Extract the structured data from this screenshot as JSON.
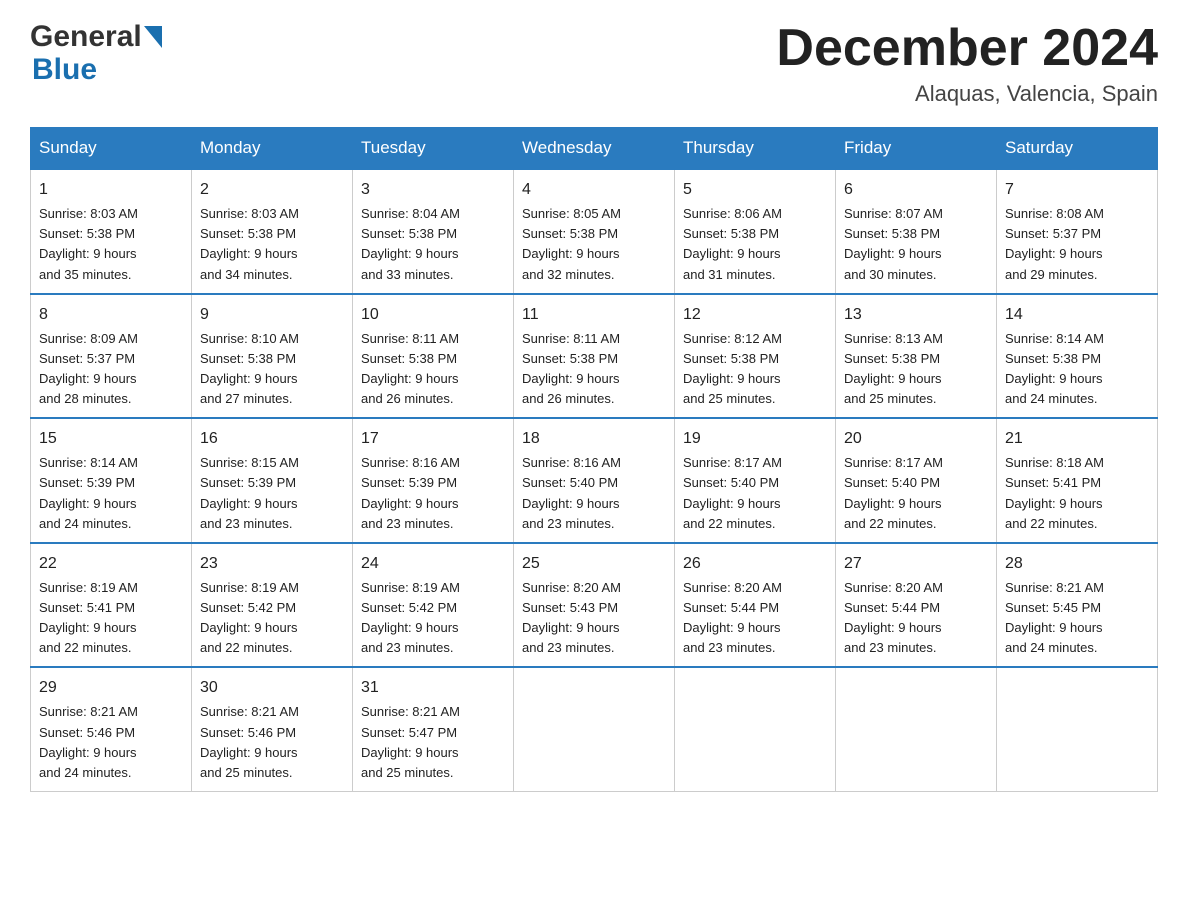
{
  "header": {
    "logo_line1": "General",
    "logo_line2": "Blue",
    "month_title": "December 2024",
    "location": "Alaquas, Valencia, Spain"
  },
  "days_of_week": [
    "Sunday",
    "Monday",
    "Tuesday",
    "Wednesday",
    "Thursday",
    "Friday",
    "Saturday"
  ],
  "weeks": [
    [
      {
        "day": "1",
        "sunrise": "8:03 AM",
        "sunset": "5:38 PM",
        "daylight": "9 hours and 35 minutes."
      },
      {
        "day": "2",
        "sunrise": "8:03 AM",
        "sunset": "5:38 PM",
        "daylight": "9 hours and 34 minutes."
      },
      {
        "day": "3",
        "sunrise": "8:04 AM",
        "sunset": "5:38 PM",
        "daylight": "9 hours and 33 minutes."
      },
      {
        "day": "4",
        "sunrise": "8:05 AM",
        "sunset": "5:38 PM",
        "daylight": "9 hours and 32 minutes."
      },
      {
        "day": "5",
        "sunrise": "8:06 AM",
        "sunset": "5:38 PM",
        "daylight": "9 hours and 31 minutes."
      },
      {
        "day": "6",
        "sunrise": "8:07 AM",
        "sunset": "5:38 PM",
        "daylight": "9 hours and 30 minutes."
      },
      {
        "day": "7",
        "sunrise": "8:08 AM",
        "sunset": "5:37 PM",
        "daylight": "9 hours and 29 minutes."
      }
    ],
    [
      {
        "day": "8",
        "sunrise": "8:09 AM",
        "sunset": "5:37 PM",
        "daylight": "9 hours and 28 minutes."
      },
      {
        "day": "9",
        "sunrise": "8:10 AM",
        "sunset": "5:38 PM",
        "daylight": "9 hours and 27 minutes."
      },
      {
        "day": "10",
        "sunrise": "8:11 AM",
        "sunset": "5:38 PM",
        "daylight": "9 hours and 26 minutes."
      },
      {
        "day": "11",
        "sunrise": "8:11 AM",
        "sunset": "5:38 PM",
        "daylight": "9 hours and 26 minutes."
      },
      {
        "day": "12",
        "sunrise": "8:12 AM",
        "sunset": "5:38 PM",
        "daylight": "9 hours and 25 minutes."
      },
      {
        "day": "13",
        "sunrise": "8:13 AM",
        "sunset": "5:38 PM",
        "daylight": "9 hours and 25 minutes."
      },
      {
        "day": "14",
        "sunrise": "8:14 AM",
        "sunset": "5:38 PM",
        "daylight": "9 hours and 24 minutes."
      }
    ],
    [
      {
        "day": "15",
        "sunrise": "8:14 AM",
        "sunset": "5:39 PM",
        "daylight": "9 hours and 24 minutes."
      },
      {
        "day": "16",
        "sunrise": "8:15 AM",
        "sunset": "5:39 PM",
        "daylight": "9 hours and 23 minutes."
      },
      {
        "day": "17",
        "sunrise": "8:16 AM",
        "sunset": "5:39 PM",
        "daylight": "9 hours and 23 minutes."
      },
      {
        "day": "18",
        "sunrise": "8:16 AM",
        "sunset": "5:40 PM",
        "daylight": "9 hours and 23 minutes."
      },
      {
        "day": "19",
        "sunrise": "8:17 AM",
        "sunset": "5:40 PM",
        "daylight": "9 hours and 22 minutes."
      },
      {
        "day": "20",
        "sunrise": "8:17 AM",
        "sunset": "5:40 PM",
        "daylight": "9 hours and 22 minutes."
      },
      {
        "day": "21",
        "sunrise": "8:18 AM",
        "sunset": "5:41 PM",
        "daylight": "9 hours and 22 minutes."
      }
    ],
    [
      {
        "day": "22",
        "sunrise": "8:19 AM",
        "sunset": "5:41 PM",
        "daylight": "9 hours and 22 minutes."
      },
      {
        "day": "23",
        "sunrise": "8:19 AM",
        "sunset": "5:42 PM",
        "daylight": "9 hours and 22 minutes."
      },
      {
        "day": "24",
        "sunrise": "8:19 AM",
        "sunset": "5:42 PM",
        "daylight": "9 hours and 23 minutes."
      },
      {
        "day": "25",
        "sunrise": "8:20 AM",
        "sunset": "5:43 PM",
        "daylight": "9 hours and 23 minutes."
      },
      {
        "day": "26",
        "sunrise": "8:20 AM",
        "sunset": "5:44 PM",
        "daylight": "9 hours and 23 minutes."
      },
      {
        "day": "27",
        "sunrise": "8:20 AM",
        "sunset": "5:44 PM",
        "daylight": "9 hours and 23 minutes."
      },
      {
        "day": "28",
        "sunrise": "8:21 AM",
        "sunset": "5:45 PM",
        "daylight": "9 hours and 24 minutes."
      }
    ],
    [
      {
        "day": "29",
        "sunrise": "8:21 AM",
        "sunset": "5:46 PM",
        "daylight": "9 hours and 24 minutes."
      },
      {
        "day": "30",
        "sunrise": "8:21 AM",
        "sunset": "5:46 PM",
        "daylight": "9 hours and 25 minutes."
      },
      {
        "day": "31",
        "sunrise": "8:21 AM",
        "sunset": "5:47 PM",
        "daylight": "9 hours and 25 minutes."
      },
      null,
      null,
      null,
      null
    ]
  ]
}
